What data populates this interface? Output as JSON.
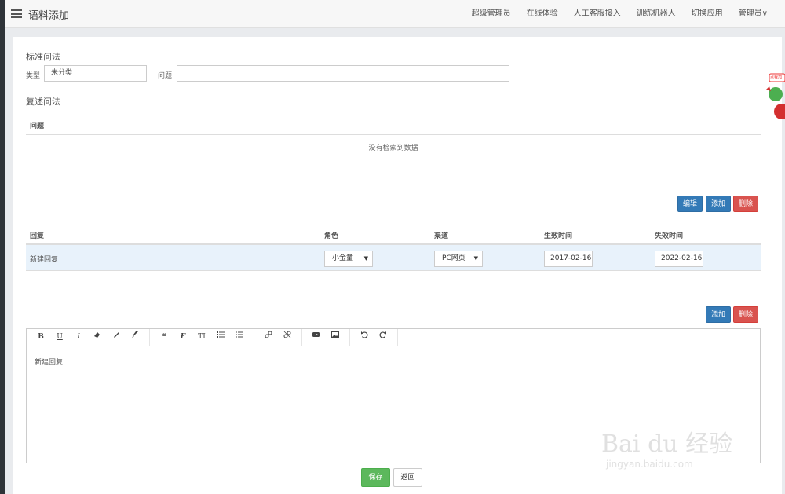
{
  "header": {
    "title": "语料添加",
    "nav": [
      "超级管理员",
      "在线体验",
      "人工客服接入",
      "训练机器人",
      "切换应用",
      "管理员∨"
    ]
  },
  "standard": {
    "title": "标准问法",
    "type_label": "类型",
    "type_value": "未分类",
    "question_label": "问题",
    "question_value": ""
  },
  "paraphrase": {
    "title": "复述问法",
    "column": "问题",
    "empty": "没有检索到数据"
  },
  "buttons": {
    "edit": "编辑",
    "add": "添加",
    "delete": "删除",
    "save": "保存",
    "back": "返回"
  },
  "reply_table": {
    "columns": [
      "回复",
      "角色",
      "渠道",
      "生效时间",
      "失效时间"
    ],
    "row": {
      "reply": "新建回复",
      "role": "小金童",
      "channel": "PC网页",
      "start": "2017-02-16",
      "end": "2022-02-16"
    }
  },
  "editor": {
    "tools": [
      "B",
      "U",
      "I",
      "eraser",
      "pen",
      "brush",
      "❝",
      "F",
      "TI",
      "ul",
      "ol",
      "link",
      "unlink",
      "video",
      "image",
      "undo",
      "redo"
    ],
    "content": "新建回复"
  },
  "watermark": {
    "brand": "Bai du 经验",
    "url": "jingyan.baidu.com"
  },
  "badge": {
    "text": "点我加"
  }
}
